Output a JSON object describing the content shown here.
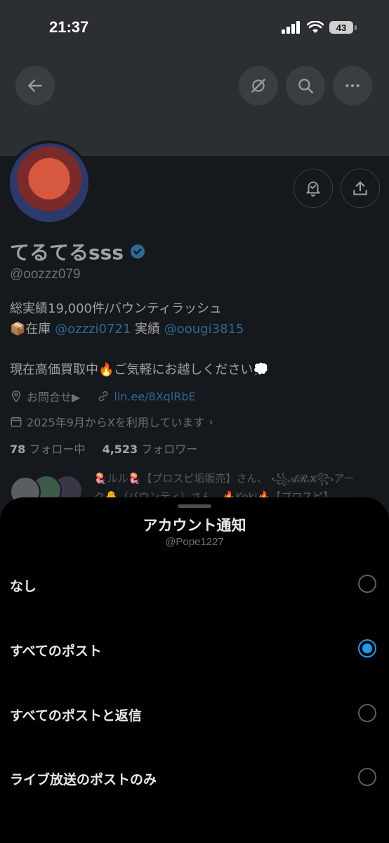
{
  "status_bar": {
    "time": "21:37",
    "battery": "43"
  },
  "profile": {
    "display_name": "てるてるsss",
    "handle": "@oozzz079",
    "bio": {
      "line1": "総実績19,000件/バウンティラッシュ",
      "line2_prefix": "📦在庫 ",
      "line2_link1": "@ozzzi0721",
      "line2_mid": " 実績 ",
      "line2_link2": "@oougi3815",
      "line3": "現在高価買取中🔥ご気軽にお越しください💭"
    },
    "location": "お問合せ▶",
    "website": "lin.ee/8XqlRbE",
    "joined": "2025年9月からXを利用しています",
    "following_count": "78",
    "following_label": "フォロー中",
    "followers_count": "4,523",
    "followers_label": "フォロワー",
    "followed_by_line1": "🪼ルル🪼【プロスピ垢販売】さん、 ꧁𝓐𝓡𝓚꧂アー",
    "followed_by_line2": "ク🐥（バウンティ）さん、🔥Koki🔥【プロスピ】"
  },
  "sheet": {
    "title": "アカウント通知",
    "subtitle": "@Pope1227",
    "options": [
      {
        "label": "なし",
        "selected": false
      },
      {
        "label": "すべてのポスト",
        "selected": true
      },
      {
        "label": "すべてのポストと返信",
        "selected": false
      },
      {
        "label": "ライブ放送のポストのみ",
        "selected": false
      }
    ]
  },
  "colors": {
    "accent": "#1d9bf0",
    "link_dimmed": "#2d6a94",
    "sheet_bg": "#000000"
  },
  "icons": [
    "back-arrow-icon",
    "grok-icon",
    "search-icon",
    "more-icon",
    "notification-bell-icon",
    "share-icon",
    "location-icon",
    "link-icon",
    "calendar-icon",
    "verified-badge-icon"
  ]
}
